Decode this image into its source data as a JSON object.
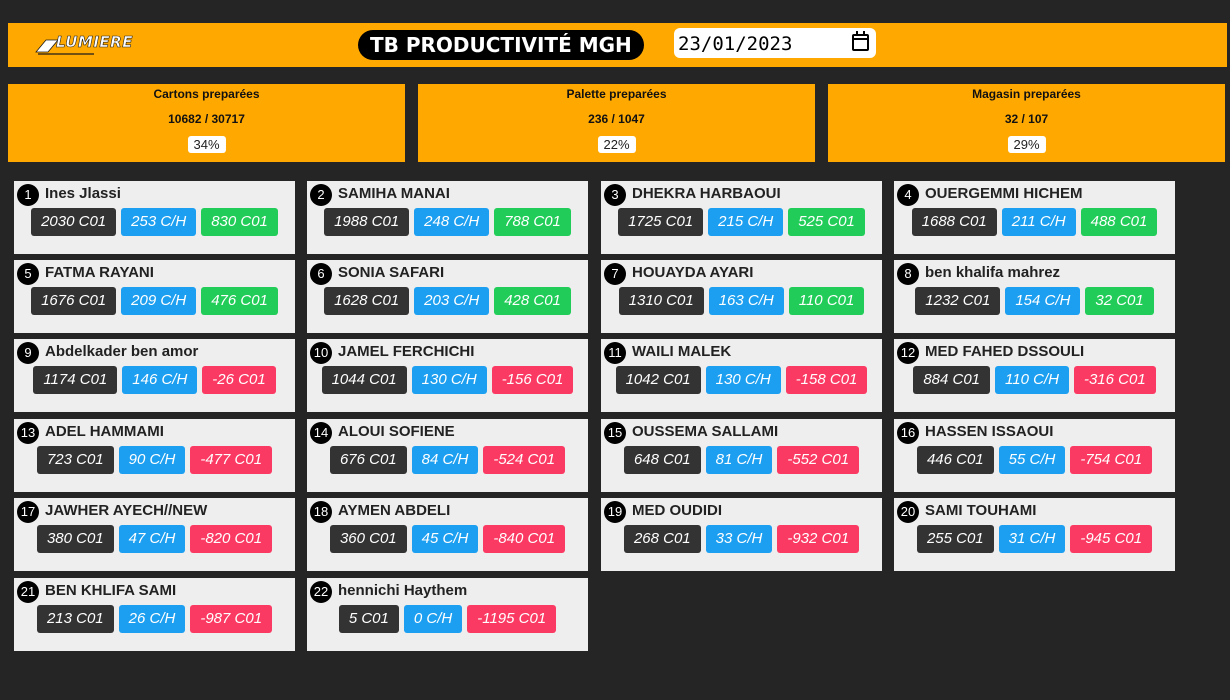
{
  "header": {
    "logo_text": "LUMIERE",
    "title": "TB PRODUCTIVITÉ MGH",
    "date": "23/01/2023"
  },
  "summaries": [
    {
      "label": "Cartons preparées",
      "value": "10682 / 30717",
      "percent": "34%"
    },
    {
      "label": "Palette preparées",
      "value": "236 / 1047",
      "percent": "22%"
    },
    {
      "label": "Magasin preparées",
      "value": "32 / 107",
      "percent": "29%"
    }
  ],
  "workers": [
    {
      "rank": "1",
      "name": "Ines Jlassi",
      "total": "2030 C01",
      "rate": "253 C/H",
      "diff": "830 C01",
      "diff_status": "positive"
    },
    {
      "rank": "2",
      "name": "SAMIHA MANAI",
      "total": "1988 C01",
      "rate": "248 C/H",
      "diff": "788 C01",
      "diff_status": "positive"
    },
    {
      "rank": "3",
      "name": "DHEKRA HARBAOUI",
      "total": "1725 C01",
      "rate": "215 C/H",
      "diff": "525 C01",
      "diff_status": "positive"
    },
    {
      "rank": "4",
      "name": "OUERGEMMI HICHEM",
      "total": "1688 C01",
      "rate": "211 C/H",
      "diff": "488 C01",
      "diff_status": "positive"
    },
    {
      "rank": "5",
      "name": "FATMA RAYANI",
      "total": "1676 C01",
      "rate": "209 C/H",
      "diff": "476 C01",
      "diff_status": "positive"
    },
    {
      "rank": "6",
      "name": "SONIA SAFARI",
      "total": "1628 C01",
      "rate": "203 C/H",
      "diff": "428 C01",
      "diff_status": "positive"
    },
    {
      "rank": "7",
      "name": "HOUAYDA AYARI",
      "total": "1310 C01",
      "rate": "163 C/H",
      "diff": "110 C01",
      "diff_status": "positive"
    },
    {
      "rank": "8",
      "name": "ben khalifa mahrez",
      "total": "1232 C01",
      "rate": "154 C/H",
      "diff": "32 C01",
      "diff_status": "positive"
    },
    {
      "rank": "9",
      "name": "Abdelkader ben amor",
      "total": "1174 C01",
      "rate": "146 C/H",
      "diff": "-26 C01",
      "diff_status": "negative"
    },
    {
      "rank": "10",
      "name": "JAMEL FERCHICHI",
      "total": "1044 C01",
      "rate": "130 C/H",
      "diff": "-156 C01",
      "diff_status": "negative"
    },
    {
      "rank": "11",
      "name": "WAILI MALEK",
      "total": "1042 C01",
      "rate": "130 C/H",
      "diff": "-158 C01",
      "diff_status": "negative"
    },
    {
      "rank": "12",
      "name": "MED FAHED DSSOULI",
      "total": "884 C01",
      "rate": "110 C/H",
      "diff": "-316 C01",
      "diff_status": "negative"
    },
    {
      "rank": "13",
      "name": "ADEL HAMMAMI",
      "total": "723 C01",
      "rate": "90 C/H",
      "diff": "-477 C01",
      "diff_status": "negative"
    },
    {
      "rank": "14",
      "name": "ALOUI SOFIENE",
      "total": "676 C01",
      "rate": "84 C/H",
      "diff": "-524 C01",
      "diff_status": "negative"
    },
    {
      "rank": "15",
      "name": "OUSSEMA SALLAMI",
      "total": "648 C01",
      "rate": "81 C/H",
      "diff": "-552 C01",
      "diff_status": "negative"
    },
    {
      "rank": "16",
      "name": "HASSEN ISSAOUI",
      "total": "446 C01",
      "rate": "55 C/H",
      "diff": "-754 C01",
      "diff_status": "negative"
    },
    {
      "rank": "17",
      "name": "JAWHER AYECH//NEW",
      "total": "380 C01",
      "rate": "47 C/H",
      "diff": "-820 C01",
      "diff_status": "negative"
    },
    {
      "rank": "18",
      "name": "AYMEN ABDELI",
      "total": "360 C01",
      "rate": "45 C/H",
      "diff": "-840 C01",
      "diff_status": "negative"
    },
    {
      "rank": "19",
      "name": "MED OUDIDI",
      "total": "268 C01",
      "rate": "33 C/H",
      "diff": "-932 C01",
      "diff_status": "negative"
    },
    {
      "rank": "20",
      "name": "SAMI TOUHAMI",
      "total": "255 C01",
      "rate": "31 C/H",
      "diff": "-945 C01",
      "diff_status": "negative"
    },
    {
      "rank": "21",
      "name": "BEN KHLIFA SAMI",
      "total": "213 C01",
      "rate": "26 C/H",
      "diff": "-987 C01",
      "diff_status": "negative"
    },
    {
      "rank": "22",
      "name": "hennichi Haythem",
      "total": "5 C01",
      "rate": "0 C/H",
      "diff": "-1195 C01",
      "diff_status": "negative"
    }
  ],
  "colors": {
    "accent": "#ffa800",
    "background": "#252525",
    "card": "#eeeeee",
    "total_chip": "#333333",
    "rate_chip": "#1c9ff0",
    "positive_chip": "#21cd58",
    "negative_chip": "#fb3a63"
  }
}
